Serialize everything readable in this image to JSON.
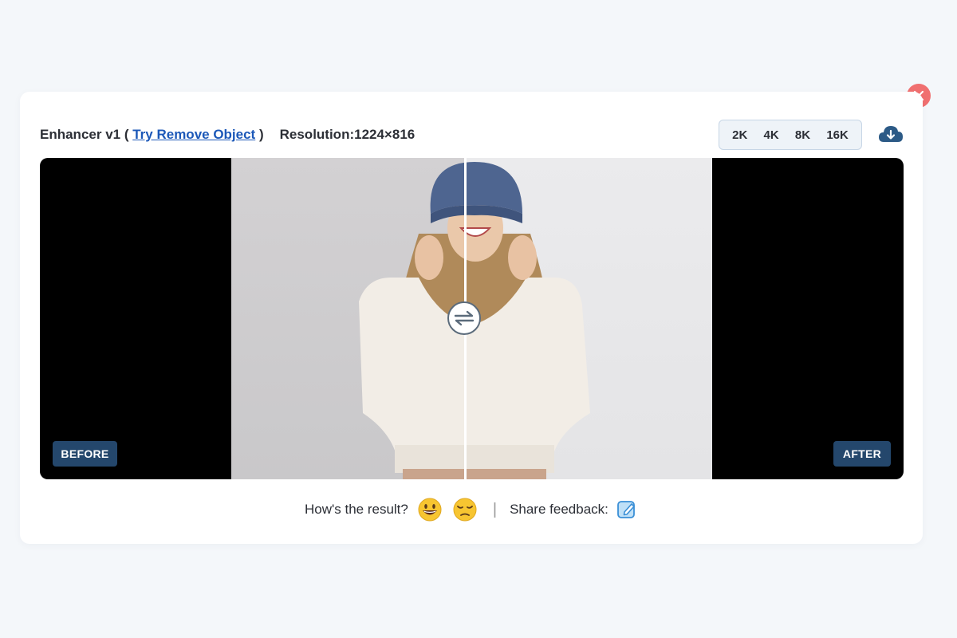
{
  "header": {
    "title_prefix": "Enhancer v1 ( ",
    "title_link": "Try Remove Object",
    "title_suffix": " )",
    "resolution": "Resolution:1224×816"
  },
  "resolution_options": [
    "2K",
    "4K",
    "8K",
    "16K"
  ],
  "viewer": {
    "before_label": "BEFORE",
    "after_label": "AFTER"
  },
  "feedback": {
    "question": "How's the result?",
    "share_label": "Share feedback:",
    "separator": "|"
  },
  "icons": {
    "close": "close-icon",
    "download": "cloud-download-icon",
    "compare": "swap-arrows-icon",
    "happy": "grinning-face-icon",
    "sad": "pensive-face-icon",
    "edit": "edit-note-icon"
  },
  "colors": {
    "close_bg": "#f07070",
    "link": "#1c58b8",
    "tag_bg": "#24476c",
    "download": "#2c5a86"
  }
}
